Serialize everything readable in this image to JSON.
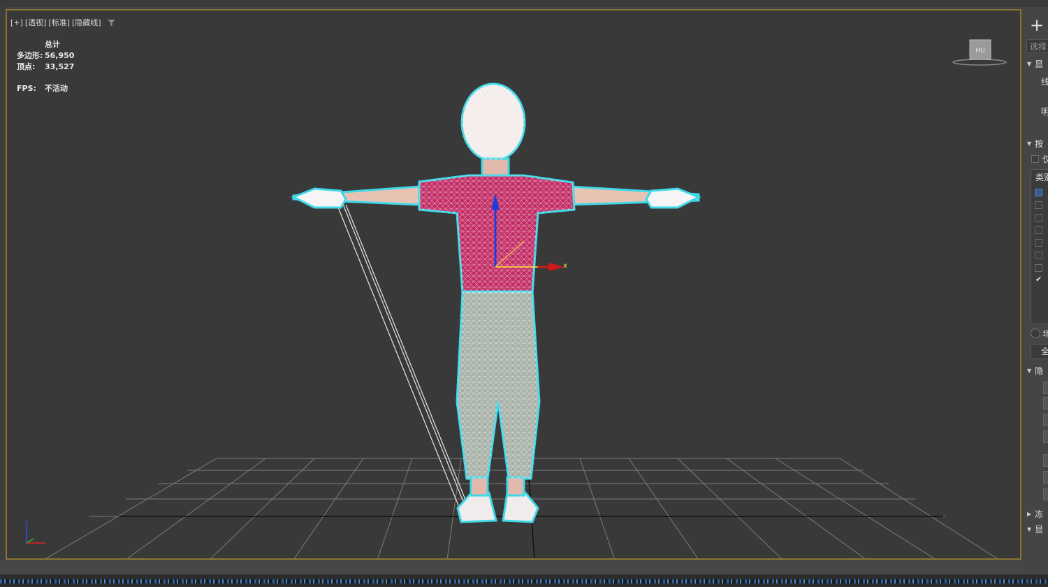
{
  "viewport": {
    "labels": [
      "[+]",
      "[透视]",
      "[标准]",
      "[隐藏线]"
    ],
    "filter_icon": "filter-icon",
    "stats": {
      "header": "总计",
      "polys_label": "多边形:",
      "polys_value": "56,950",
      "verts_label": "顶点:",
      "verts_value": "33,527",
      "fps_label": "FPS:",
      "fps_value": "不活动"
    },
    "axis_x_label": "x",
    "viewcube_label": "HU"
  },
  "right_panel": {
    "create_icon": "plus-icon",
    "select_field": "选择",
    "section_display": "显",
    "label_line": "线",
    "label_bright": "明",
    "section_filter": "按",
    "checkbox_only": "仅",
    "list_header": "类别",
    "radio_label": "场",
    "button_all": "全",
    "section_hide": "隐",
    "section_freeze": "冻",
    "section_display2": "显"
  },
  "colors": {
    "viewport_bg": "#393939",
    "viewport_border": "#8a7530",
    "wire_white": "#ffffff",
    "wire_cyan": "#3fd8e8",
    "shirt": "#c22a63",
    "skin": "#d9a08c",
    "pants": "#9aa49a"
  }
}
